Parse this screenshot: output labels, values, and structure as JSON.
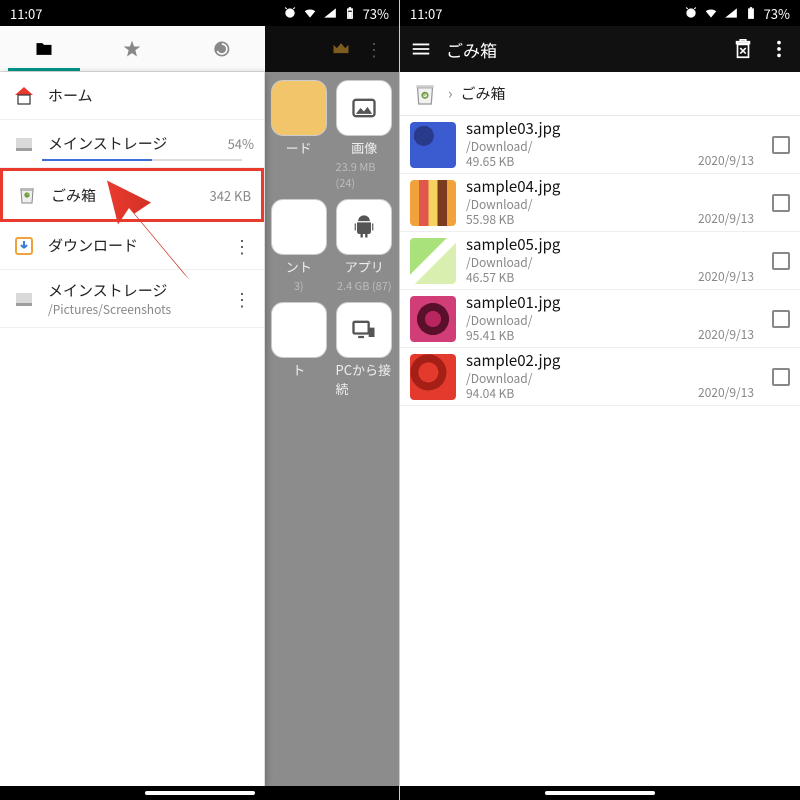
{
  "status": {
    "time": "11:07",
    "battery": "73%"
  },
  "left": {
    "tabs": [
      "folder",
      "star",
      "history"
    ],
    "items": {
      "home": {
        "label": "ホーム"
      },
      "storage": {
        "label": "メインストレージ",
        "meta": "54%"
      },
      "trash": {
        "label": "ごみ箱",
        "meta": "342 KB"
      },
      "download": {
        "label": "ダウンロード"
      },
      "pinned": {
        "label": "メインストレージ",
        "sub": "/Pictures/Screenshots"
      }
    },
    "underlay": {
      "r1": [
        {
          "label": "ード",
          "sub": ""
        },
        {
          "label": "画像",
          "sub": "23.9 MB (24)"
        }
      ],
      "r2": [
        {
          "label": "ント",
          "sub": "3)"
        },
        {
          "label": "アプリ",
          "sub": "2.4 GB (87)"
        }
      ],
      "r3": [
        {
          "label": "ト",
          "sub": ""
        },
        {
          "label": "PCから接続",
          "sub": ""
        }
      ]
    }
  },
  "right": {
    "title": "ごみ箱",
    "breadcrumb": "ごみ箱",
    "files": [
      {
        "name": "sample03.jpg",
        "path": "/Download/",
        "size": "49.65 KB",
        "date": "2020/9/13"
      },
      {
        "name": "sample04.jpg",
        "path": "/Download/",
        "size": "55.98 KB",
        "date": "2020/9/13"
      },
      {
        "name": "sample05.jpg",
        "path": "/Download/",
        "size": "46.57 KB",
        "date": "2020/9/13"
      },
      {
        "name": "sample01.jpg",
        "path": "/Download/",
        "size": "95.41 KB",
        "date": "2020/9/13"
      },
      {
        "name": "sample02.jpg",
        "path": "/Download/",
        "size": "94.04 KB",
        "date": "2020/9/13"
      }
    ]
  }
}
